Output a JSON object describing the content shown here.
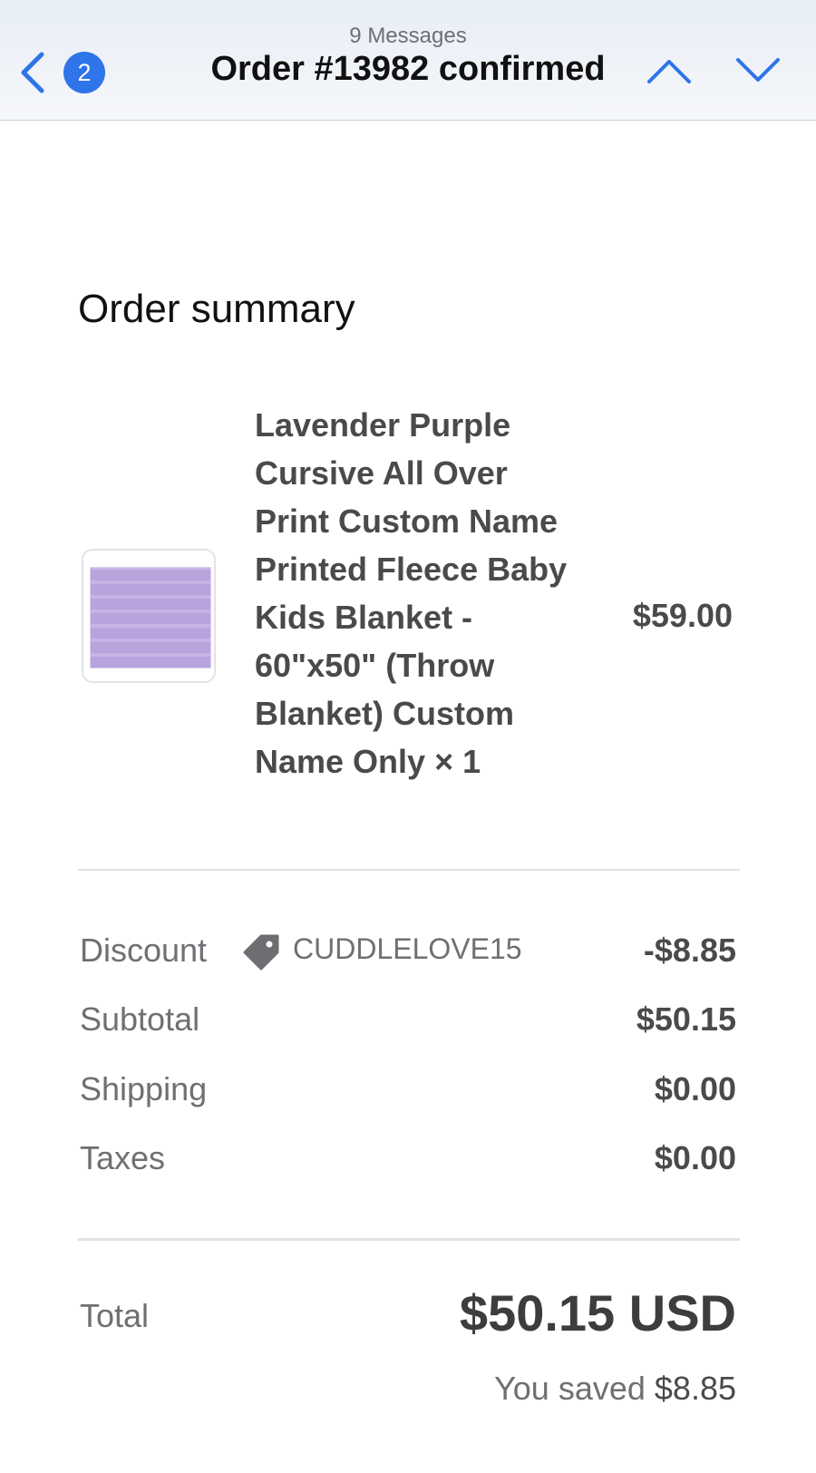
{
  "header": {
    "back_label": "Back",
    "unread_count": "2",
    "message_count": "9 Messages",
    "title": "Order #13982 confirmed"
  },
  "summary": {
    "title": "Order summary",
    "item": {
      "name": "Lavender Purple Cursive All Over Print Custom Name Printed Fleece Baby Kids Blanket - 60\"x50\" (Throw Blanket) Custom Name Only × 1",
      "price": "$59.00"
    },
    "discount": {
      "label": "Discount",
      "code": "CUDDLELOVE15",
      "value": "-$8.85"
    },
    "subtotal": {
      "label": "Subtotal",
      "value": "$50.15"
    },
    "shipping": {
      "label": "Shipping",
      "value": "$0.00"
    },
    "taxes": {
      "label": "Taxes",
      "value": "$0.00"
    },
    "total": {
      "label": "Total",
      "value": "$50.15 USD"
    },
    "saved_prefix": "You saved",
    "saved_amount": "$8.85"
  },
  "colors": {
    "accent": "#2f74e8",
    "text_muted": "#6f6f74",
    "text_strong": "#4a4a4d"
  }
}
